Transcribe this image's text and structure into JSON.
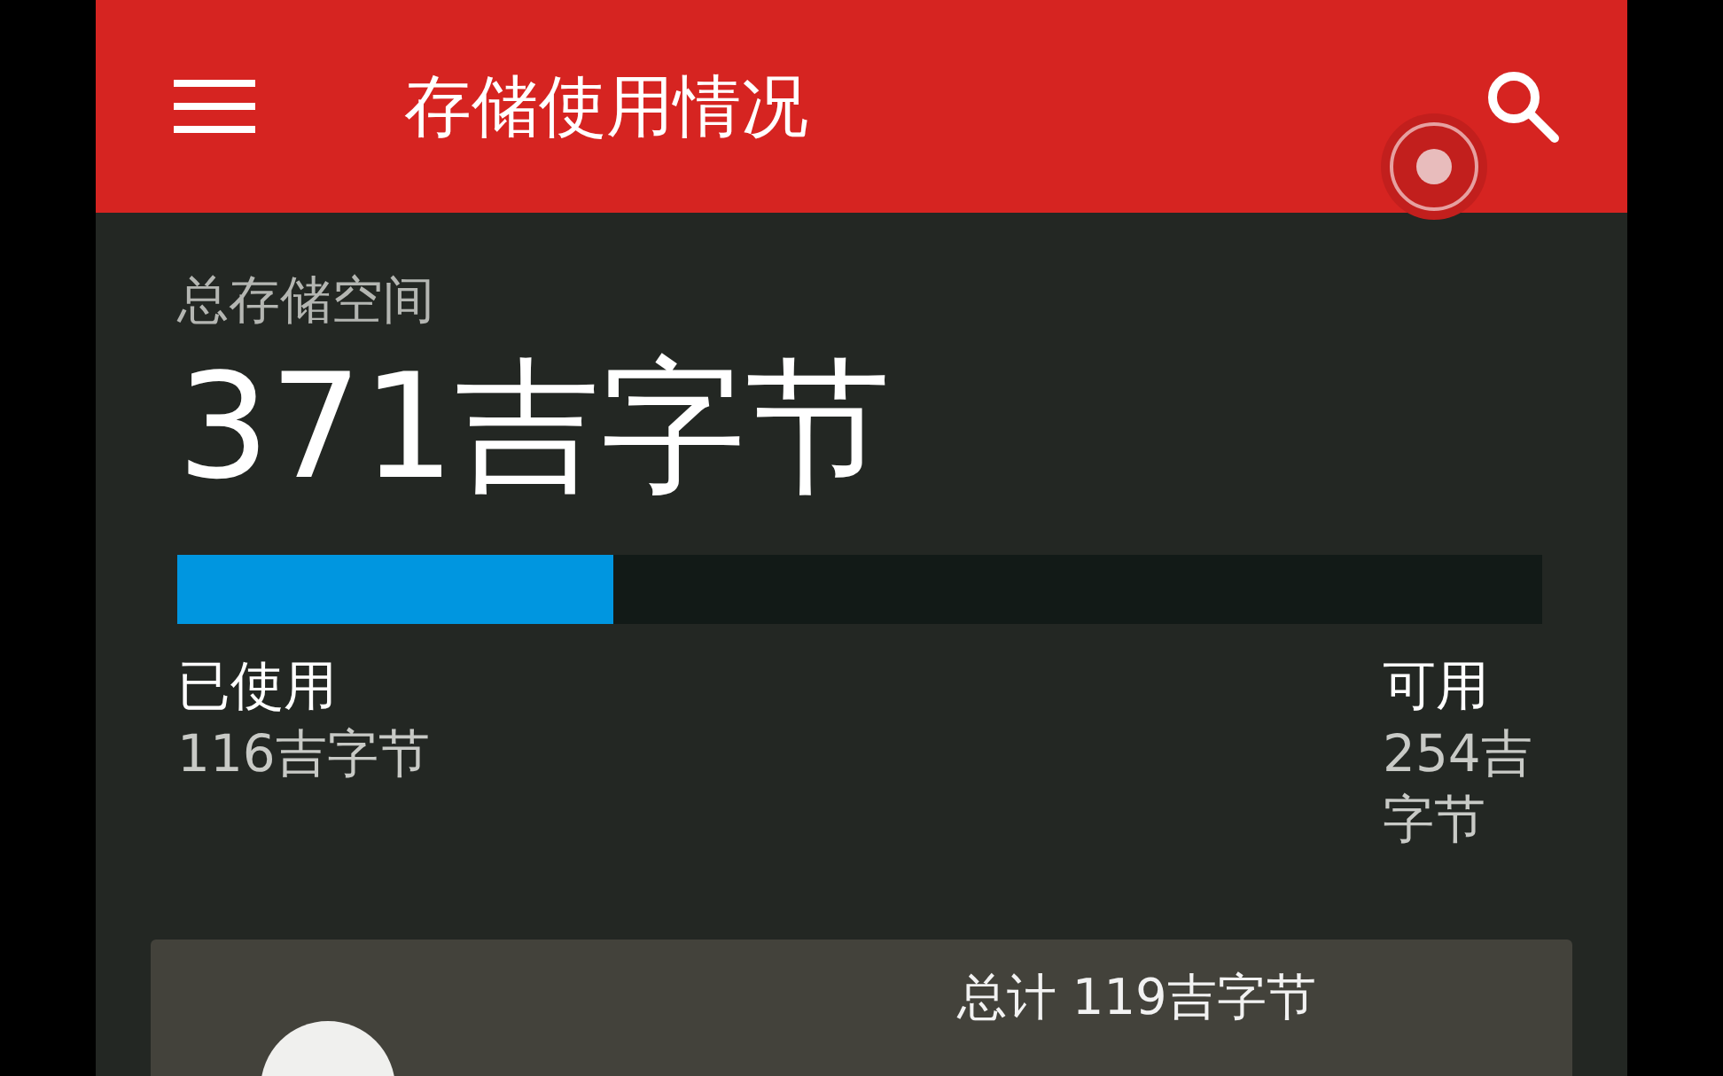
{
  "app_bar": {
    "title": "存储使用情况"
  },
  "summary": {
    "label": "总存储空间",
    "total": "371吉字节",
    "usage_bar": {
      "level": 0.32
    },
    "used": {
      "label": "已使用",
      "value": "116吉字节"
    },
    "free": {
      "label": "可用",
      "value": "254吉字节"
    }
  },
  "card": {
    "total": "总计 119吉字节"
  }
}
